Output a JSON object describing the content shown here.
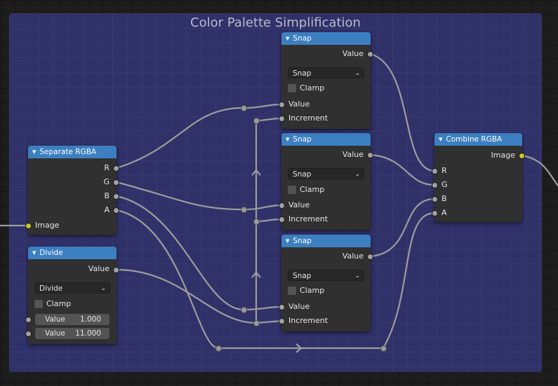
{
  "frame": {
    "title": "Color Palette Simplification"
  },
  "nodes": {
    "snap1": {
      "title": "Snap",
      "output_label": "Value",
      "mode": "Snap",
      "clamp_label": "Clamp",
      "inputs": [
        "Value",
        "Increment"
      ]
    },
    "snap2": {
      "title": "Snap",
      "output_label": "Value",
      "mode": "Snap",
      "clamp_label": "Clamp",
      "inputs": [
        "Value",
        "Increment"
      ]
    },
    "snap3": {
      "title": "Snap",
      "output_label": "Value",
      "mode": "Snap",
      "clamp_label": "Clamp",
      "inputs": [
        "Value",
        "Increment"
      ]
    },
    "separate": {
      "title": "Separate RGBA",
      "outputs": [
        "R",
        "G",
        "B",
        "A"
      ],
      "input_label": "Image"
    },
    "divide": {
      "title": "Divide",
      "output_label": "Value",
      "mode": "Divide",
      "clamp_label": "Clamp",
      "fields": [
        {
          "label": "Value",
          "value": "1.000"
        },
        {
          "label": "Value",
          "value": "11.000"
        }
      ]
    },
    "combine": {
      "title": "Combine RGBA",
      "output_label": "Image",
      "inputs": [
        "R",
        "G",
        "B",
        "A"
      ]
    }
  },
  "colors": {
    "header": "#3c7fc1",
    "frame": "#313169",
    "wire": "#9d9d9d",
    "image_socket": "#c7c729"
  }
}
